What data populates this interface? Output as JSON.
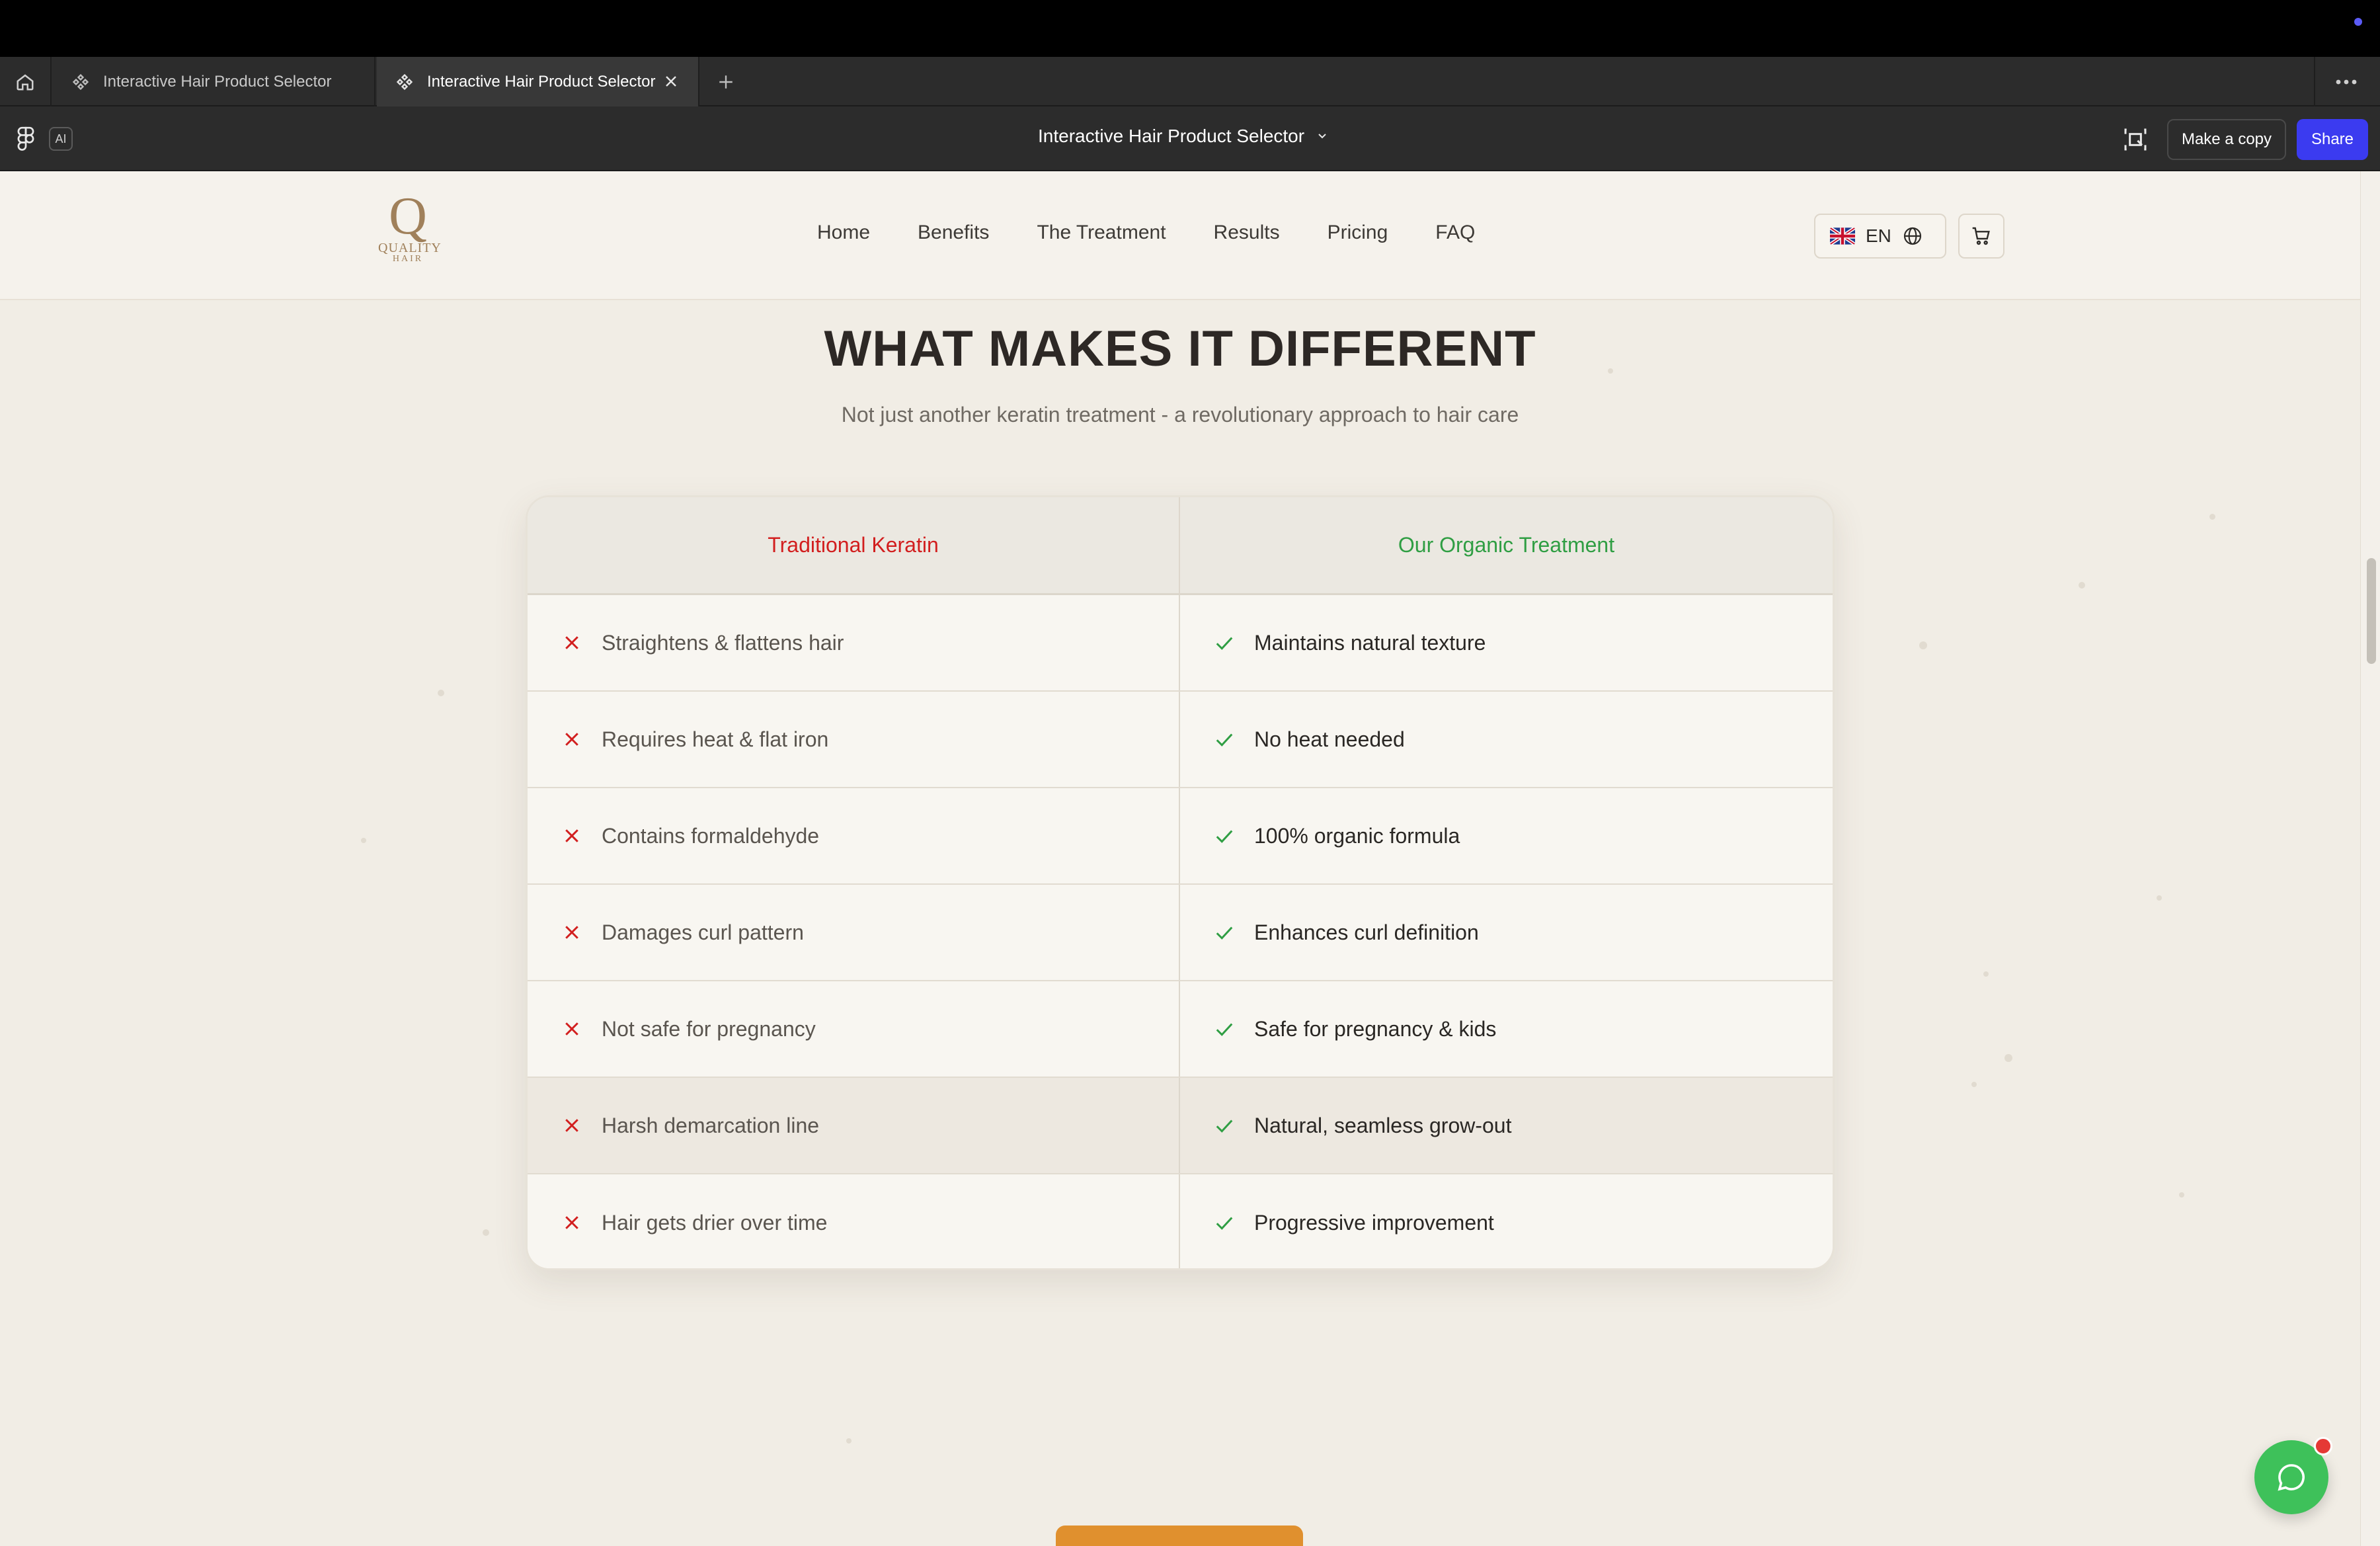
{
  "browser": {
    "tabs": [
      {
        "label": "Interactive Hair Product Selector",
        "active": false
      },
      {
        "label": "Interactive Hair Product Selector",
        "active": true
      }
    ]
  },
  "toolbar": {
    "ai_label": "AI",
    "file_title": "Interactive Hair Product Selector",
    "make_copy_label": "Make a copy",
    "share_label": "Share"
  },
  "site": {
    "logo": {
      "letter": "Q",
      "line1": "QUALITY",
      "line2": "HAIR"
    },
    "nav": [
      "Home",
      "Benefits",
      "The Treatment",
      "Results",
      "Pricing",
      "FAQ"
    ],
    "language": "EN"
  },
  "section": {
    "title": "WHAT MAKES IT DIFFERENT",
    "subtitle": "Not just another keratin treatment - a revolutionary approach to hair care"
  },
  "comparison": {
    "left_header": "Traditional Keratin",
    "right_header": "Our Organic Treatment",
    "rows": [
      {
        "left": "Straightens & flattens hair",
        "right": "Maintains natural texture"
      },
      {
        "left": "Requires heat & flat iron",
        "right": "No heat needed"
      },
      {
        "left": "Contains formaldehyde",
        "right": "100% organic formula"
      },
      {
        "left": "Damages curl pattern",
        "right": "Enhances curl definition"
      },
      {
        "left": "Not safe for pregnancy",
        "right": "Safe for pregnancy & kids"
      },
      {
        "left": "Harsh demarcation line",
        "right": "Natural, seamless grow-out"
      },
      {
        "left": "Hair gets drier over time",
        "right": "Progressive improvement"
      }
    ]
  },
  "colors": {
    "negative": "#d21e1e",
    "positive": "#2f9e43",
    "accent": "#3b3bf0",
    "chat": "#3ec15a"
  }
}
